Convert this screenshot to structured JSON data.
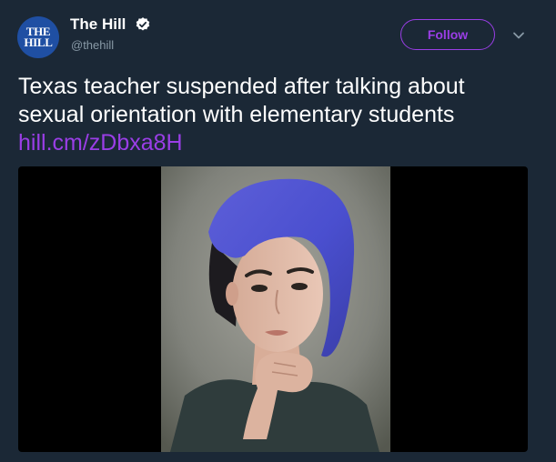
{
  "account": {
    "avatar_text_line1": "THE",
    "avatar_text_line2": "HILL",
    "display_name": "The Hill",
    "handle": "@thehill",
    "verified": true
  },
  "actions": {
    "follow_label": "Follow",
    "menu_icon": "chevron-down-icon"
  },
  "tweet": {
    "text_line1": "Texas teacher suspended after talking about",
    "text_line2": "sexual orientation with elementary students",
    "link": "hill.cm/zDbxa8H"
  },
  "media": {
    "type": "photo"
  },
  "colors": {
    "background": "#1b2836",
    "accent": "#9a3ee6",
    "secondary_text": "#8899a6",
    "avatar_bg": "#1f4fa3"
  }
}
